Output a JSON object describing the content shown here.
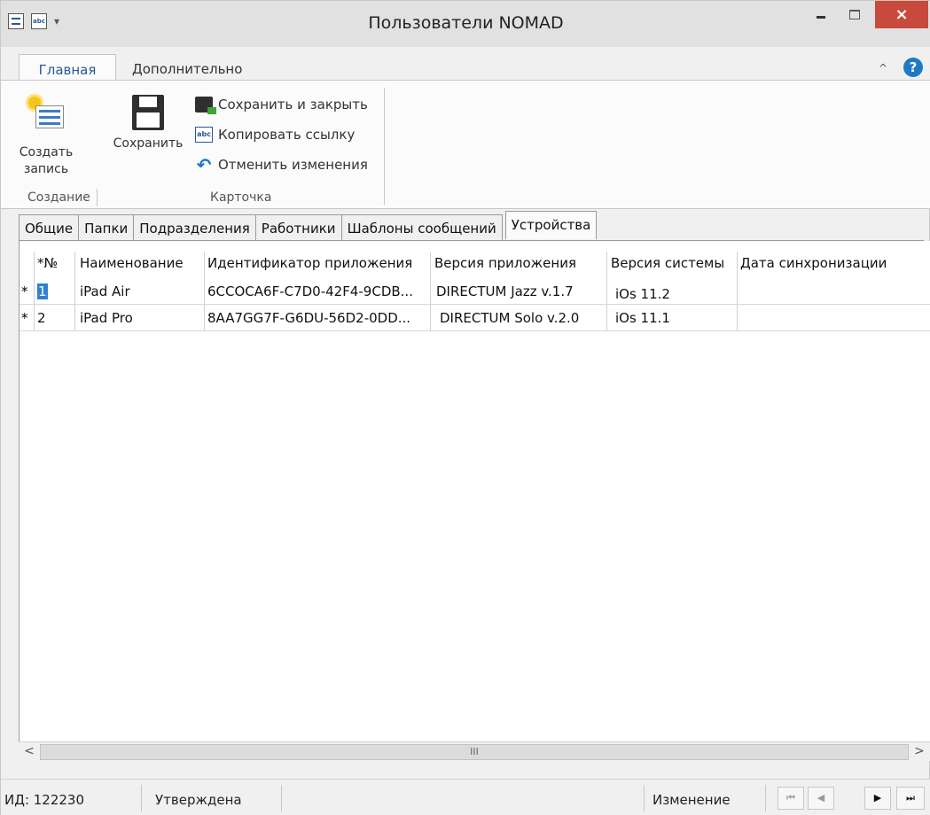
{
  "window": {
    "title": "Пользователи NOMAD",
    "close_glyph": "×"
  },
  "quick_access": {
    "icons": [
      "list-icon",
      "abc-icon"
    ],
    "dropdown_glyph": "▾",
    "abc_glyph": "abc"
  },
  "ribbon": {
    "tabs": [
      "Главная",
      "Дополнительно"
    ],
    "collapse_glyph": "^",
    "help_glyph": "?",
    "create_label_1": "Создать",
    "create_label_2": "запись",
    "save_label": "Сохранить",
    "save_close_label": "Сохранить и закрыть",
    "copy_link_label": "Копировать ссылку",
    "undo_label": "Отменить изменения",
    "group_create": "Создание",
    "group_card": "Карточка",
    "abc_glyph": "abc",
    "undo_glyph": "↶"
  },
  "form_tabs": [
    "Общие",
    "Папки",
    "Подразделения",
    "Работники",
    "Шаблоны сообщений",
    "Устройства"
  ],
  "grid": {
    "headers": [
      "*№",
      "Наименование",
      "Идентификатор приложения",
      "Версия приложения",
      "Версия системы",
      "Дата синхронизации"
    ],
    "rows": [
      {
        "marker": "*",
        "num": "1",
        "name": "iPad Air",
        "app_id": "6CCOCA6F-C7D0-42F4-9CDB...",
        "app_version": "DIRECTUM Jazz v.1.7",
        "os_version": "iOs 11.2",
        "sync_date": ""
      },
      {
        "marker": "*",
        "num": "2",
        "name": "iPad Pro",
        "app_id": "8AA7GG7F-G6DU-56D2-0DD...",
        "app_version": "DIRECTUM Solo v.2.0",
        "os_version": "iOs 11.1",
        "sync_date": ""
      }
    ]
  },
  "scrollbar": {
    "left_glyph": "<",
    "right_glyph": ">",
    "thumb_glyph": "III"
  },
  "status": {
    "id": "ИД: 122230",
    "state": "Утверждена",
    "mode": "Изменение",
    "nav_glyphs": [
      "⏮",
      "◀",
      "▶",
      "⏭"
    ]
  }
}
